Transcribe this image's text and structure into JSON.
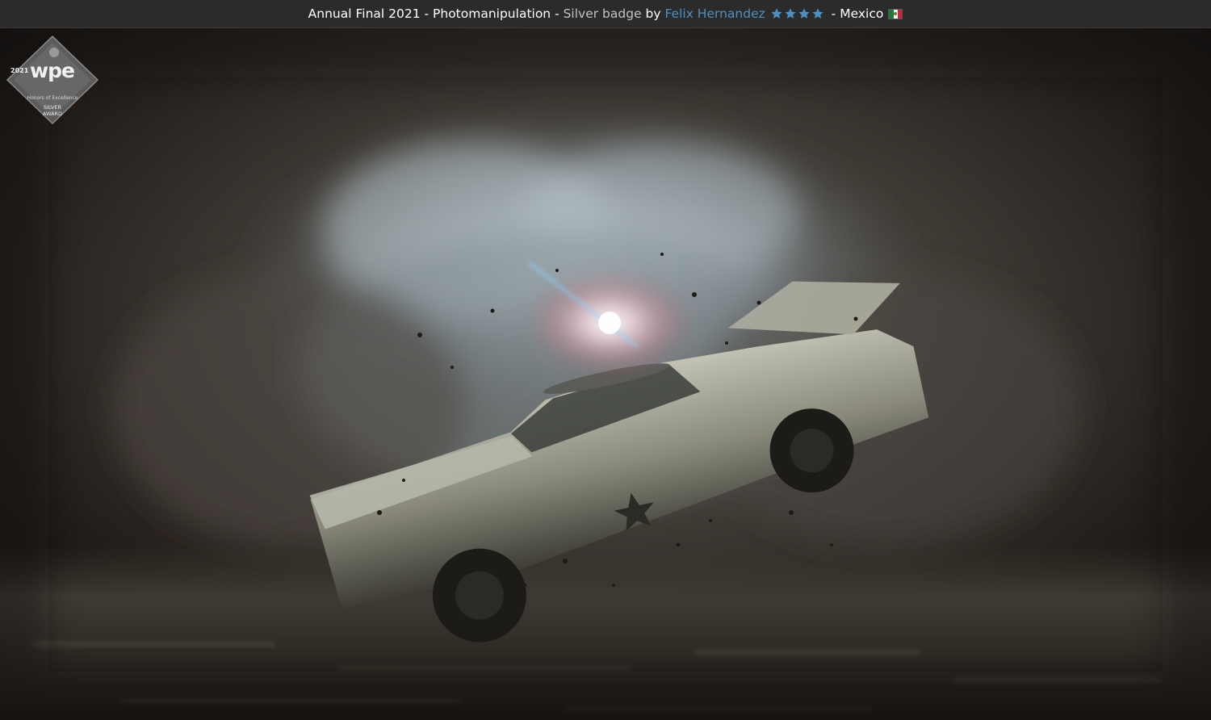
{
  "header": {
    "competition": "Annual Final 2021",
    "separator1": " - ",
    "category": "Photomanipulation",
    "separator2": " - ",
    "badge": "Silver badge",
    "by": " by ",
    "author": "Felix Hernandez",
    "stars": 4,
    "separator3": " - ",
    "country": "Mexico",
    "flag_icon": "mexico-flag-icon",
    "star_color": "#4f8fbf",
    "author_color": "#4f8fbf"
  },
  "award": {
    "year": "2021",
    "logo": "wpe",
    "honors": "Honors of Excellence",
    "silver": "SILVER",
    "award": "AWARD"
  }
}
